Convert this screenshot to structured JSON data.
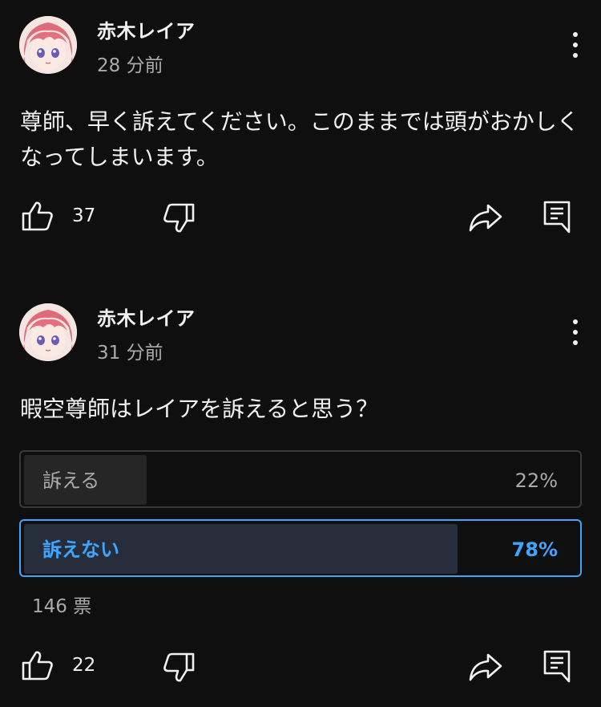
{
  "colors": {
    "background": "#0f0f0f",
    "text_primary": "#f1f1f1",
    "text_secondary": "#aaaaaa",
    "accent": "#3ea6ff",
    "poll_fill_selected": "#282d3c",
    "poll_fill": "#262626"
  },
  "posts": [
    {
      "author": "赤木レイア",
      "time": "28 分前",
      "text": "尊師、早く訴えてください。このままでは頭がおかしくなってしまいます。",
      "likes": "37",
      "icons": [
        "avatar",
        "more-vert-icon",
        "thumb-up-icon",
        "thumb-down-icon",
        "share-icon",
        "comment-icon"
      ]
    },
    {
      "author": "赤木レイア",
      "time": "31 分前",
      "text": "暇空尊師はレイアを訴えると思う？",
      "poll": {
        "options": [
          {
            "label": "訴える",
            "percent": "22%",
            "value": 22,
            "selected": false
          },
          {
            "label": "訴えない",
            "percent": "78%",
            "value": 78,
            "selected": true
          }
        ],
        "votes": "146 票"
      },
      "likes": "22",
      "icons": [
        "avatar",
        "more-vert-icon",
        "thumb-up-icon",
        "thumb-down-icon",
        "share-icon",
        "comment-icon"
      ]
    }
  ]
}
